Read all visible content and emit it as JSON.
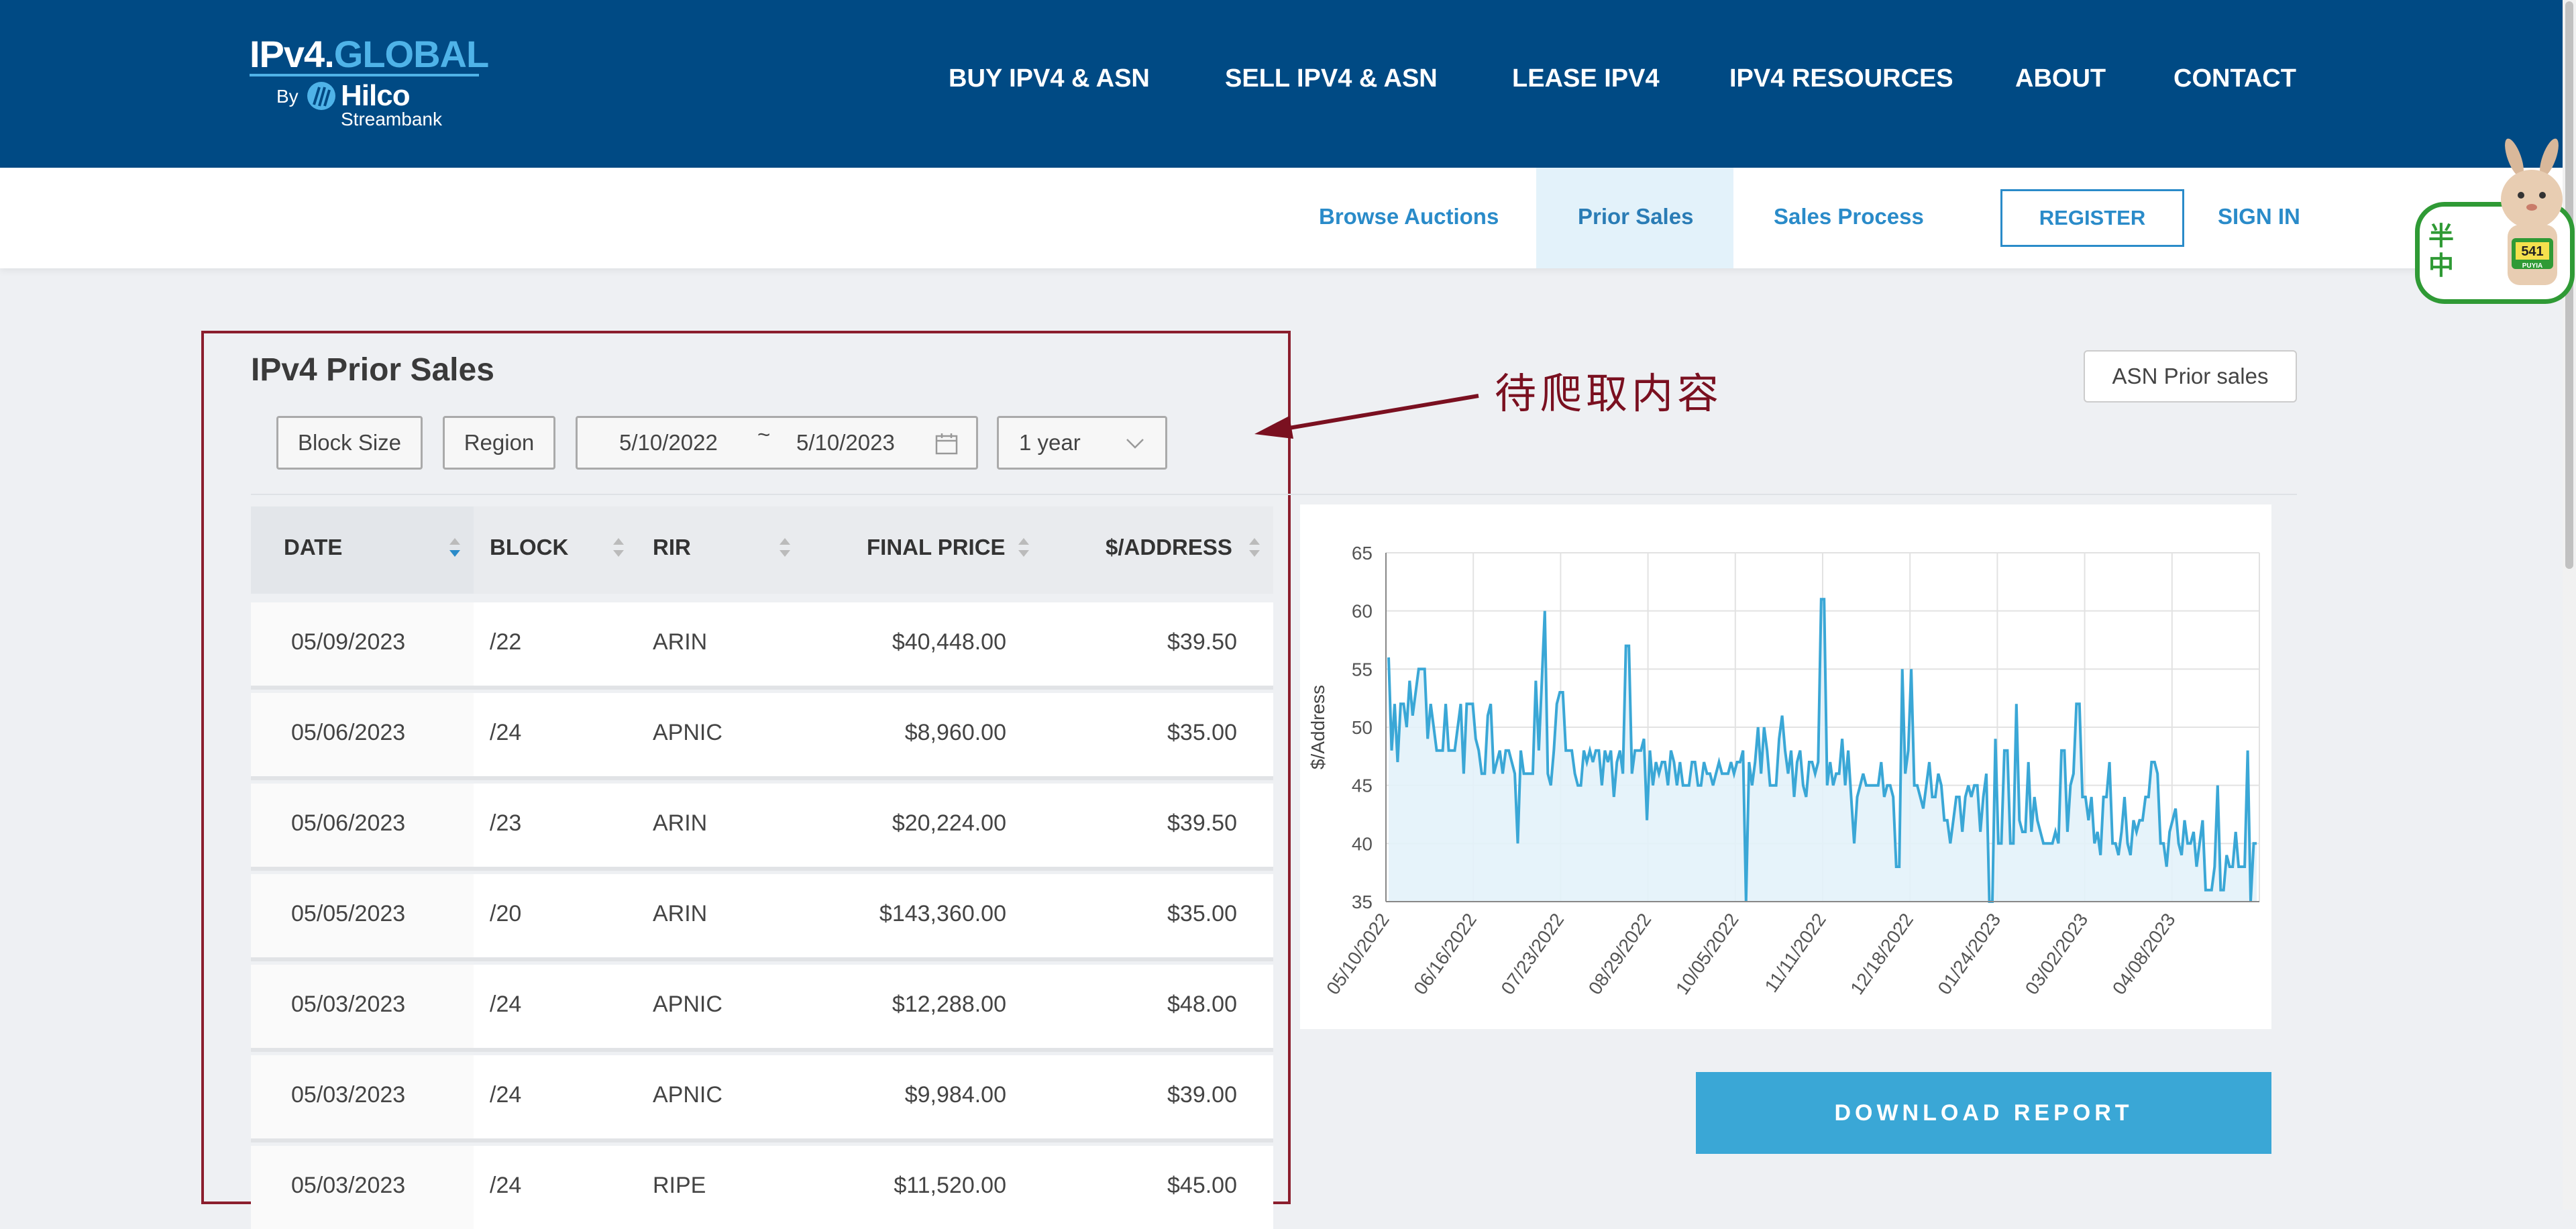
{
  "header": {
    "logo": {
      "prefix": "IPv4.",
      "suffix": "GLOBAL",
      "by": "By",
      "brand": "Hilco",
      "sub": "Streambank"
    },
    "nav": [
      "BUY IPV4 & ASN",
      "SELL IPV4 & ASN",
      "LEASE IPV4",
      "IPV4 RESOURCES",
      "ABOUT",
      "CONTACT"
    ]
  },
  "subnav": {
    "links": [
      "Browse Auctions",
      "Prior Sales",
      "Sales Process"
    ],
    "active": "Prior Sales",
    "register": "REGISTER",
    "signin": "SIGN IN"
  },
  "mascot": {
    "text": "半中",
    "badge": "541",
    "sub": "PUYIA"
  },
  "section": {
    "title": "IPv4 Prior Sales",
    "asn_button": "ASN Prior sales",
    "annotation": "待爬取内容"
  },
  "filters": {
    "block_size": "Block Size",
    "region": "Region",
    "date_from": "5/10/2022",
    "date_sep": "~",
    "date_to": "5/10/2023",
    "period": "1 year"
  },
  "table": {
    "columns": [
      "DATE",
      "BLOCK",
      "RIR",
      "FINAL PRICE",
      "$/ADDRESS"
    ],
    "rows": [
      [
        "05/09/2023",
        "/22",
        "ARIN",
        "$40,448.00",
        "$39.50"
      ],
      [
        "05/06/2023",
        "/24",
        "APNIC",
        "$8,960.00",
        "$35.00"
      ],
      [
        "05/06/2023",
        "/23",
        "ARIN",
        "$20,224.00",
        "$39.50"
      ],
      [
        "05/05/2023",
        "/20",
        "ARIN",
        "$143,360.00",
        "$35.00"
      ],
      [
        "05/03/2023",
        "/24",
        "APNIC",
        "$12,288.00",
        "$48.00"
      ],
      [
        "05/03/2023",
        "/24",
        "APNIC",
        "$9,984.00",
        "$39.00"
      ],
      [
        "05/03/2023",
        "/24",
        "RIPE",
        "$11,520.00",
        "$45.00"
      ]
    ]
  },
  "download_label": "DOWNLOAD REPORT",
  "chart_data": {
    "type": "area",
    "title": "",
    "xlabel": "",
    "ylabel": "$/Address",
    "ylim": [
      35,
      65
    ],
    "yticks": [
      35,
      40,
      45,
      50,
      55,
      60,
      65
    ],
    "xticks": [
      "05/10/2022",
      "06/16/2022",
      "07/23/2022",
      "08/29/2022",
      "10/05/2022",
      "11/11/2022",
      "12/18/2022",
      "01/24/2023",
      "03/02/2023",
      "04/08/2023"
    ],
    "grid": true,
    "line_color": "#3aa7d6",
    "fill_color": "#e3f2f9",
    "series": [
      {
        "values": [
          56,
          48,
          52,
          47,
          52,
          52,
          50,
          54,
          51,
          53,
          55,
          55,
          55,
          49,
          52,
          50,
          48,
          48,
          48,
          52,
          48,
          48,
          48,
          50,
          52,
          46,
          52,
          52,
          52,
          49,
          48,
          46,
          46,
          51,
          52,
          46,
          47,
          48,
          46,
          48,
          48,
          47,
          46,
          40,
          48,
          46,
          46,
          46,
          46,
          54,
          48,
          54,
          60,
          46,
          45,
          48,
          52,
          53,
          53,
          48,
          48,
          48,
          46,
          45,
          45,
          48,
          47,
          48,
          47,
          48,
          48,
          45,
          48,
          47,
          48,
          44,
          47,
          48,
          46,
          57,
          57,
          46,
          48,
          48,
          48,
          49,
          42,
          48,
          45,
          47,
          46,
          47,
          47,
          45,
          48,
          47,
          45,
          47,
          45,
          45,
          45,
          47,
          47,
          45,
          45,
          47,
          46,
          46,
          45,
          46,
          47,
          46,
          46,
          46,
          47,
          46,
          47,
          47,
          48,
          35,
          47,
          45,
          47,
          50,
          46,
          50,
          48,
          45,
          45,
          45,
          49,
          51,
          48,
          46,
          48,
          44,
          47,
          48,
          45,
          44,
          47,
          47,
          46,
          47,
          61,
          61,
          45,
          47,
          45,
          46,
          46,
          49,
          45,
          48,
          44,
          40,
          44,
          45,
          46,
          45,
          45,
          45,
          45,
          45,
          47,
          44,
          45,
          45,
          44,
          38,
          38,
          55,
          46,
          48,
          55,
          45,
          45,
          44,
          43,
          45,
          47,
          44,
          44,
          46,
          45,
          42,
          42,
          40,
          42,
          44,
          44,
          41,
          44,
          45,
          44,
          45,
          45,
          41,
          44,
          46,
          35,
          35,
          49,
          40,
          40,
          48,
          48,
          40,
          40,
          52,
          42,
          41,
          41,
          47,
          41,
          44,
          42,
          41,
          40,
          40,
          40,
          40,
          41,
          40,
          48,
          48,
          41,
          45,
          46,
          52,
          52,
          44,
          44,
          42,
          44,
          40,
          41,
          39,
          44,
          44,
          47,
          40,
          40,
          39,
          41,
          44,
          40,
          39,
          42,
          41,
          42,
          42,
          44,
          44,
          47,
          47,
          46,
          40,
          40,
          38,
          41,
          42,
          43,
          40,
          39,
          42,
          40,
          40,
          41,
          38,
          40,
          42,
          36,
          36,
          36,
          38,
          45,
          36,
          36,
          39,
          38,
          38,
          41,
          38,
          38,
          38,
          48,
          35,
          40,
          40
        ]
      }
    ]
  }
}
